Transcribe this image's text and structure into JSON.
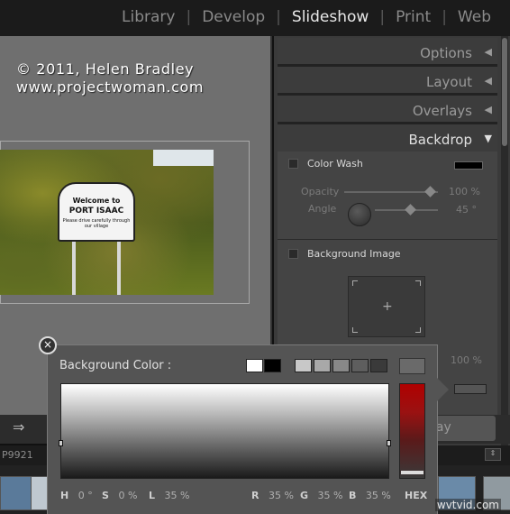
{
  "modules": [
    "Library",
    "Develop",
    "Slideshow",
    "Print",
    "Web"
  ],
  "active_module": "Slideshow",
  "slide": {
    "copyright_line1": "© 2011, Helen Bradley",
    "copyright_line2": "www.projectwoman.com",
    "sign_line1": "Welcome to",
    "sign_line2": "PORT ISAAC",
    "sign_line3": "Please drive carefully through our village"
  },
  "panels": {
    "options": "Options",
    "layout": "Layout",
    "overlays": "Overlays",
    "backdrop": "Backdrop"
  },
  "backdrop": {
    "color_wash": "Color Wash",
    "opacity_label": "Opacity",
    "opacity_value": "100",
    "opacity_unit": "%",
    "angle_label": "Angle",
    "angle_value": "45",
    "angle_unit": "°",
    "background_image": "Background Image",
    "bg_opacity_value": "100",
    "bg_opacity_unit": "%",
    "plus": "+"
  },
  "toolbar": {
    "arrow": "⇒",
    "play_partial": "lay"
  },
  "filmstrip": {
    "filename_partial": "P9921",
    "dropdown": "⇕"
  },
  "color_picker": {
    "title": "Background Color :",
    "close": "×",
    "H_label": "H",
    "H_value": "0",
    "H_unit": "°",
    "S_label": "S",
    "S_value": "0",
    "S_unit": "%",
    "L_label": "L",
    "L_value": "35",
    "L_unit": "%",
    "R_label": "R",
    "R_value": "35",
    "R_unit": "%",
    "G_label": "G",
    "G_value": "35",
    "G_unit": "%",
    "B_label": "B",
    "B_value": "35",
    "B_unit": "%",
    "hex_label": "HEX",
    "swatches": [
      "#ffffff",
      "#000000",
      "#c8c8c8",
      "#a8a8a8",
      "#888888",
      "#5e5e5e",
      "#3a3a3a"
    ]
  },
  "watermark": "wvtvid.com"
}
